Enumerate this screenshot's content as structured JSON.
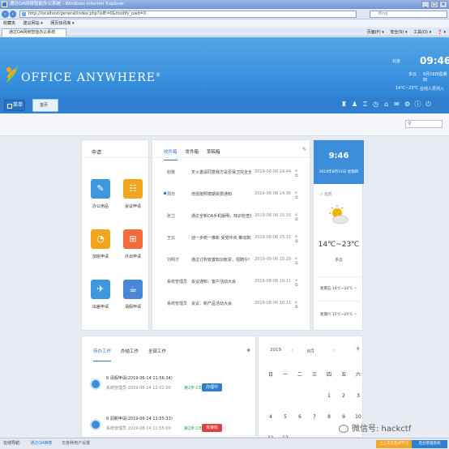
{
  "browser": {
    "title": "通达OA网络智能办公系统 - Windows Internet Explorer",
    "url": "http://localhost/general/index.php?isIE=0&modify_pwd=0",
    "search_placeholder": "Bing",
    "favorites_label": "收藏夹",
    "fav_items": [
      "建议网站 ▾",
      "网页快讯库 ▾"
    ],
    "tab_label": "通达OA网络智能办公系统",
    "tools": [
      "页面(P) ▾",
      "安全(S) ▾",
      "工具(O) ▾",
      "❓ ▾"
    ]
  },
  "header": {
    "logo_text": "OFFICE ANYWHERE",
    "logo_reg": "®",
    "city": "北京",
    "time": "09:46",
    "weather_short": "多云",
    "date": "6月16日星期四",
    "temp": "14℃~23℃",
    "online": "在线人员列入"
  },
  "nav": {
    "menu_label": "菜单",
    "home_tab": "首页",
    "close": "×"
  },
  "apps": {
    "title": "申请",
    "items": [
      {
        "label": "办公用品",
        "color": "#3c97de",
        "glyph": "✎"
      },
      {
        "label": "会议申请",
        "color": "#f0a51c",
        "glyph": "☷"
      },
      {
        "label": "加班申请",
        "color": "#f0a51c",
        "glyph": "◔"
      },
      {
        "label": "外出申请",
        "color": "#f26b3a",
        "glyph": "⊞"
      },
      {
        "label": "出差申请",
        "color": "#3c97de",
        "glyph": "✈"
      },
      {
        "label": "请假申请",
        "color": "#4a86d8",
        "glyph": "☕"
      }
    ]
  },
  "mail": {
    "tabs": [
      "收件箱",
      "发件箱",
      "草稿箱"
    ],
    "rows": [
      {
        "from": "赵敬",
        "subject": "天火邀请同意我方是否保卫完全全部",
        "time": "2019-08-08 14:44"
      },
      {
        "from": "周日",
        "subject": "增强按照按期资费通知",
        "time": "2019-08-08 14:36"
      },
      {
        "from": "张兰",
        "subject": "通达全新OA手机版明，知识检查抽查改正工作!",
        "time": "2019-08-06 15:33"
      },
      {
        "from": "王云",
        "subject": "迎一步统一推新 受党中央 推动数据监督",
        "time": "2019-08-06 15:31"
      },
      {
        "from": "刘明才",
        "subject": "通过订购安置知识帐票，招聘中！",
        "time": "2019-08-06 15:29"
      },
      {
        "from": "系统管理员",
        "subject": "会议通知：客户活动大会",
        "time": "2019-08-06 10:11"
      },
      {
        "from": "系统管理员",
        "subject": "会议：新产品活动大会",
        "time": "2019-08-06 10:11"
      }
    ]
  },
  "weather": {
    "time": "9:46",
    "date": "2019年8月14日 星期四",
    "city": "北京",
    "range": "14℃~23℃",
    "condition": "多云",
    "forecast": [
      {
        "text": "星期五 14℃~24℃"
      },
      {
        "text": "星期六 15℃~25℃"
      }
    ]
  },
  "work": {
    "tabs": [
      "待办工作",
      "办结工作",
      "全部工作"
    ],
    "items": [
      {
        "title": "9   请假申请(2019-06-14 11:56:34)",
        "meta": "系统管理员  2019-08-14 12:02:00",
        "status": "第2步:CEO审批",
        "button": "办理中",
        "btn_color": "#2e7fcf"
      },
      {
        "title": "9   调薪申请(2019-06-14 11:55:33)",
        "meta": "系统管理员  2019-08-14 11:55:00",
        "status": "第2步:CEO审批",
        "button": "未接收",
        "btn_color": "#e04040"
      }
    ]
  },
  "calendar": {
    "year": "2019",
    "month": "8月",
    "weekdays": [
      "日",
      "一",
      "二",
      "三",
      "四",
      "五",
      "六"
    ],
    "dates": [
      "1",
      "2",
      "3",
      "4",
      "5",
      "6",
      "7",
      "8",
      "9",
      "10",
      "11",
      "12"
    ]
  },
  "statusbar": {
    "left": "在线导航:",
    "link": "通达OA推荐",
    "sub": "无各种用户设置",
    "btn1": "上上去交互式学习",
    "btn2": "后台管理系统"
  },
  "watermark": "微信号: hackctf",
  "colors": {
    "header": "#3a94e0",
    "accent": "#2d7ad1",
    "sun": "#f0b400"
  }
}
